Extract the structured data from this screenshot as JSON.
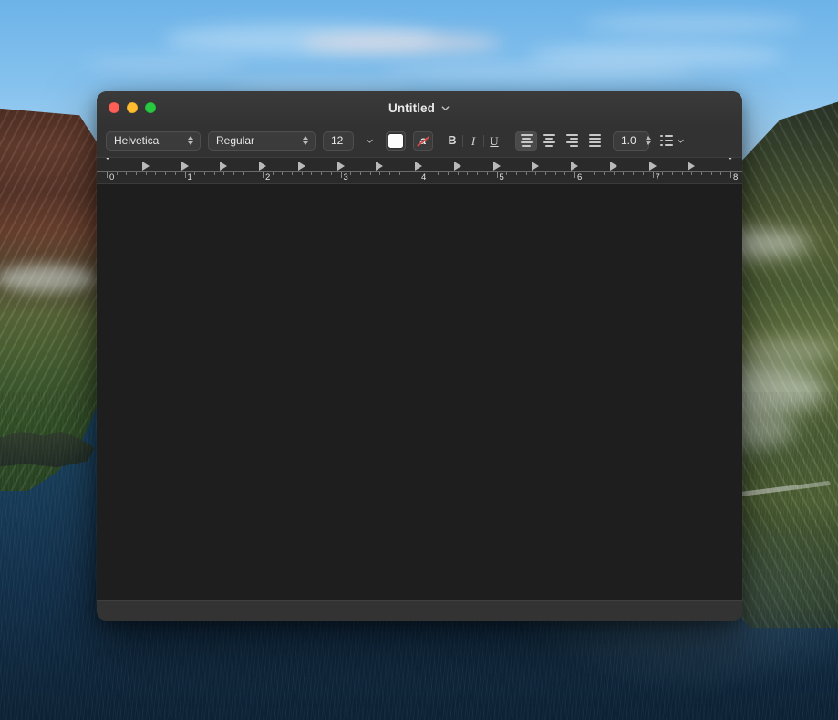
{
  "window": {
    "title": "Untitled",
    "title_chevron_icon": "chevron-down-icon",
    "traffic_lights": [
      {
        "name": "close",
        "color": "#ff5f57"
      },
      {
        "name": "minimize",
        "color": "#febc2e"
      },
      {
        "name": "zoom",
        "color": "#28c840"
      }
    ]
  },
  "toolbar": {
    "font_family": "Helvetica",
    "font_style": "Regular",
    "font_size": "12",
    "font_size_chevron_icon": "chevron-down-icon",
    "text_background_color": "#ffffff",
    "text_color_icon": "text-color-a-icon",
    "bold_label": "B",
    "italic_label": "I",
    "underline_label": "U",
    "align_left_icon": "align-left-icon",
    "align_center_icon": "align-center-icon",
    "align_right_icon": "align-right-icon",
    "align_justify_icon": "align-justify-icon",
    "active_alignment": "align-left",
    "line_spacing": "1.0",
    "list_icon": "bulleted-list-icon",
    "list_chevron_icon": "chevron-down-icon"
  },
  "ruler": {
    "unit_labels": [
      "0",
      "1",
      "2",
      "3",
      "4",
      "5",
      "6",
      "7",
      "8"
    ],
    "left_margin_marker": "left-margin-marker",
    "right_margin_marker": "right-margin-marker",
    "tab_stop_count": 15
  },
  "document": {
    "content": ""
  }
}
